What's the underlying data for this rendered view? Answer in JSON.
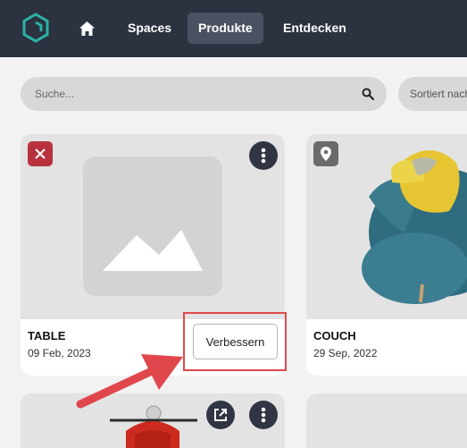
{
  "nav": {
    "spaces": "Spaces",
    "produkte": "Produkte",
    "entdecken": "Entdecken"
  },
  "search": {
    "placeholder": "Suche..."
  },
  "sort": {
    "label": "Sortiert nach"
  },
  "cards": [
    {
      "title": "TABLE",
      "date": "09 Feb, 2023",
      "action": "Verbessern"
    },
    {
      "title": "COUCH",
      "date": "29 Sep, 2022"
    }
  ],
  "colors": {
    "topbar": "#2b3240",
    "accent_teal": "#2ab3a6",
    "remove_badge": "#b8323d",
    "highlight": "#e0474c"
  },
  "icons": [
    "logo-icon",
    "home-icon",
    "search-icon",
    "close-icon",
    "more-icon",
    "location-icon",
    "open-external-icon"
  ]
}
